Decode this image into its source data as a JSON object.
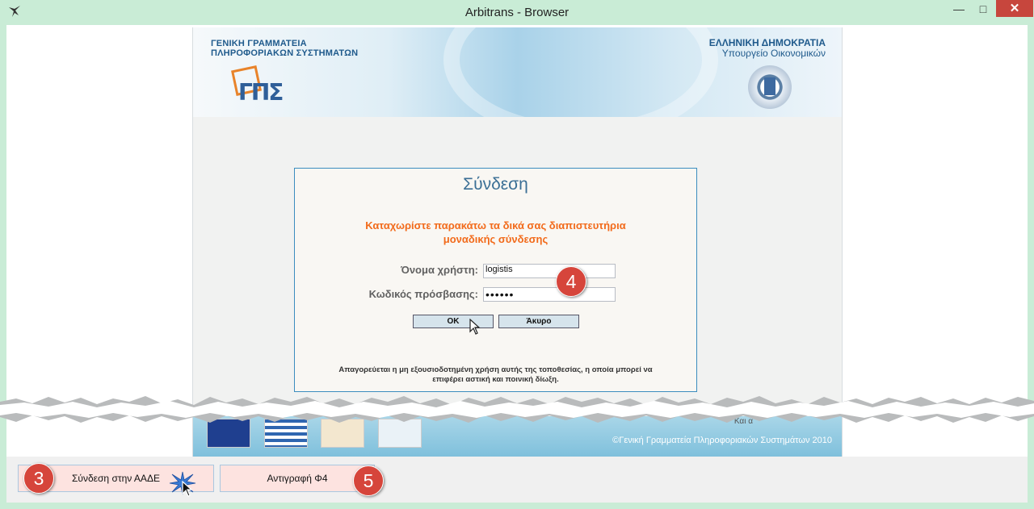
{
  "window": {
    "title": "Arbitrans - Browser",
    "min_glyph": "—",
    "max_glyph": "□",
    "close_glyph": "✕"
  },
  "banner": {
    "org_left_line1": "ΓΕΝΙΚΗ ΓΡΑΜΜΑΤΕΙΑ",
    "org_left_line2": "ΠΛΗΡΟΦΟΡΙΑΚΩΝ ΣΥΣΤΗΜΑΤΩΝ",
    "org_right_line1": "ΕΛΛΗΝΙΚΗ ΔΗΜΟΚΡΑΤΙΑ",
    "org_right_line2": "Υπουργείο Οικονομικών",
    "logo_text": "ΓΠΣ"
  },
  "login": {
    "title": "Σύνδεση",
    "instruction_line1": "Καταχωρίστε παρακάτω τα δικά σας διαπιστευτήρια",
    "instruction_line2": "μοναδικής σύνδεσης",
    "username_label": "Όνομα χρήστη:",
    "username_value": "logistis",
    "password_label": "Κωδικός πρόσβασης:",
    "password_value": "••••••",
    "ok_label": "ΟΚ",
    "cancel_label": "Άκυρο",
    "warning_line1": "Απαγορεύεται η μη εξουσιοδοτημένη χρήση αυτής της τοποθεσίας, η οποία μπορεί να",
    "warning_line2": "επιφέρει αστική και ποινική δίωξη."
  },
  "footer": {
    "partial_text": "Και α",
    "copyright": "©Γενική Γραμματεία Πληροφοριακών Συστημάτων 2010"
  },
  "bottom_bar": {
    "connect_button": "Σύνδεση στην ΑΑΔΕ",
    "copy_button": "Αντιγραφή Φ4"
  },
  "badges": {
    "b3": "3",
    "b4": "4",
    "b5": "5"
  },
  "colors": {
    "window_frame": "#c9ecd6",
    "accent_orange": "#f26a1a",
    "badge_red": "#d6453b",
    "close_red": "#c7463d"
  }
}
